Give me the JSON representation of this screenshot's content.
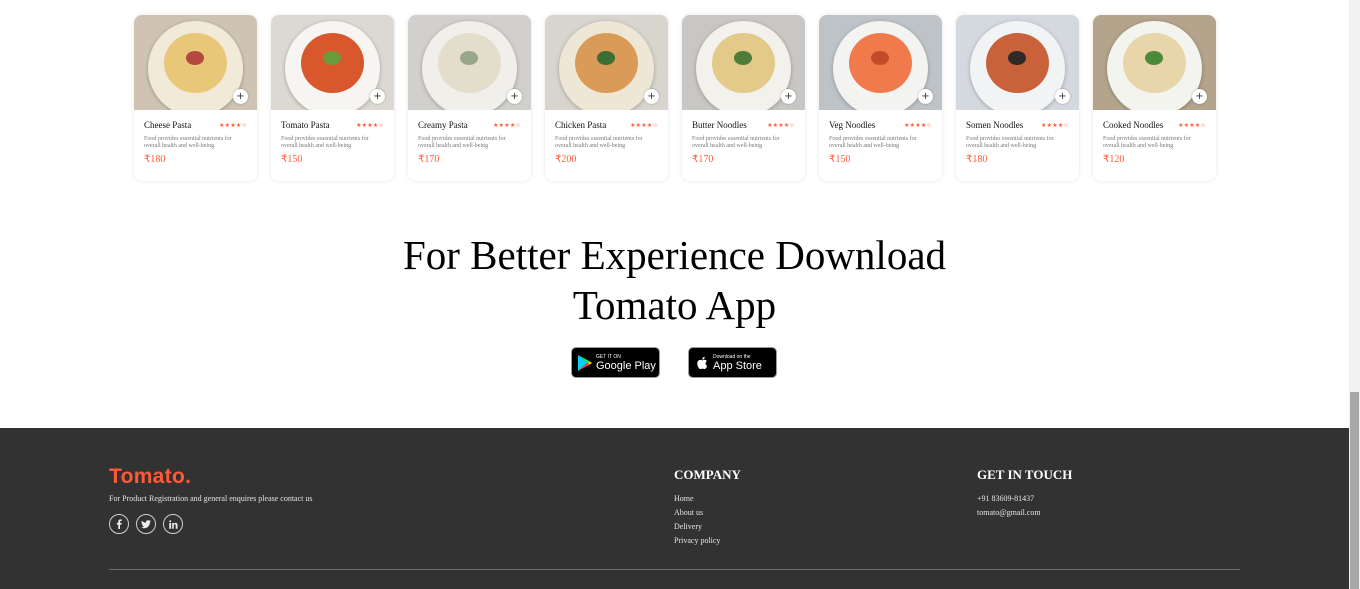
{
  "food_items": [
    {
      "name": "Cheese Pasta",
      "rating": "★★★★☆",
      "description": "Food provides essential nutrients for overall health and well-being",
      "price": "₹180",
      "bg": "#cfc4b4",
      "plate": "#f2ead8",
      "food": "#e8c779",
      "accent": "#b44a3f"
    },
    {
      "name": "Tomato Pasta",
      "rating": "★★★★☆",
      "description": "Food provides essential nutrients for overall health and well-being",
      "price": "₹150",
      "bg": "#dcd8d2",
      "plate": "#f7f5f1",
      "food": "#d9572c",
      "accent": "#6a9a3a"
    },
    {
      "name": "Creamy Pasta",
      "rating": "★★★★☆",
      "description": "Food provides essential nutrients for overall health and well-being",
      "price": "₹170",
      "bg": "#d2d0cc",
      "plate": "#f0efea",
      "food": "#e3ddcc",
      "accent": "#9aa68a"
    },
    {
      "name": "Chicken Pasta",
      "rating": "★★★★☆",
      "description": "Food provides essential nutrients for overall health and well-being",
      "price": "₹200",
      "bg": "#d8d5cf",
      "plate": "#efe7d6",
      "food": "#d99b57",
      "accent": "#3f6e35"
    },
    {
      "name": "Butter Noodles",
      "rating": "★★★★☆",
      "description": "Food provides essential nutrients for overall health and well-being",
      "price": "₹170",
      "bg": "#c9c7c3",
      "plate": "#f3f1ec",
      "food": "#e3c98a",
      "accent": "#4e7b3a"
    },
    {
      "name": "Veg Noodles",
      "rating": "★★★★☆",
      "description": "Food provides essential nutrients for overall health and well-being",
      "price": "₹150",
      "bg": "#bdc3c7",
      "plate": "#f3f3f2",
      "food": "#f07a4b",
      "accent": "#c44a2a"
    },
    {
      "name": "Somen Noodles",
      "rating": "★★★★☆",
      "description": "Food provides essential nutrients for overall health and well-being",
      "price": "₹180",
      "bg": "#d4d9df",
      "plate": "#f2f3f5",
      "food": "#c9623a",
      "accent": "#2f2a28"
    },
    {
      "name": "Cooked Noodles",
      "rating": "★★★★☆",
      "description": "Food provides essential nutrients for overall health and well-being",
      "price": "₹120",
      "bg": "#b4a48c",
      "plate": "#f4f4ef",
      "food": "#e8d5a9",
      "accent": "#4a8a3a"
    }
  ],
  "app_download": {
    "title_line1": "For Better Experience Download",
    "title_line2": "Tomato App",
    "google_play_small": "GET IT ON",
    "google_play_big": "Google Play",
    "app_store_small": "Download on the",
    "app_store_big": "App Store"
  },
  "footer": {
    "logo": "Tomato.",
    "tagline": "For Product Registration and general enquires please contact us",
    "socials": [
      "f",
      "t",
      "in"
    ],
    "company_title": "COMPANY",
    "company_links": [
      "Home",
      "About us",
      "Delivery",
      "Privacy policy"
    ],
    "contact_title": "GET IN TOUCH",
    "contact_items": [
      "+91 83609-81437",
      "tomato@gmail.com"
    ]
  },
  "colors": {
    "accent": "#ff5a36",
    "footer_bg": "#323232"
  }
}
